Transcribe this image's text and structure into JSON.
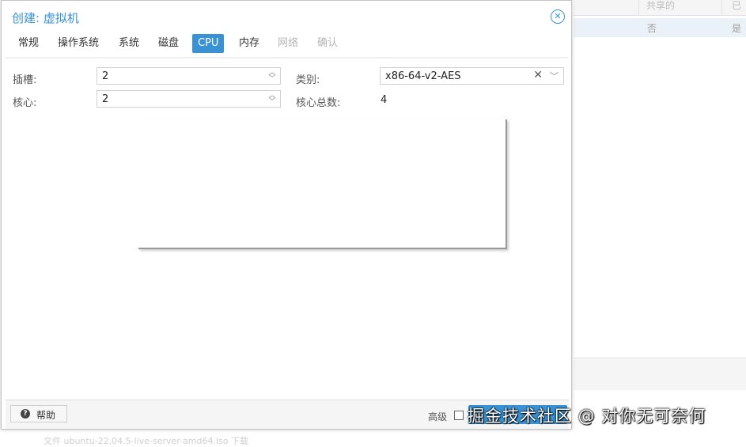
{
  "background": {
    "col_shared": "共享的",
    "col_already": "已",
    "row_no": "否",
    "row_yes": "是",
    "footer_text": "文件  ubuntu-22.04.5-live-server-amd64.iso  下载"
  },
  "dialog": {
    "title": "创建: 虚拟机",
    "close_icon": "close-circle-icon",
    "tabs": [
      {
        "label": "常规",
        "state": "normal"
      },
      {
        "label": "操作系统",
        "state": "normal"
      },
      {
        "label": "系统",
        "state": "normal"
      },
      {
        "label": "磁盘",
        "state": "normal"
      },
      {
        "label": "CPU",
        "state": "active"
      },
      {
        "label": "内存",
        "state": "normal"
      },
      {
        "label": "网络",
        "state": "disabled"
      },
      {
        "label": "确认",
        "state": "disabled"
      }
    ],
    "form": {
      "sockets_label": "插槽:",
      "sockets_value": "2",
      "cores_label": "核心:",
      "cores_value": "2",
      "type_label": "类别:",
      "type_value": "x86-64-v2-AES",
      "total_cores_label": "核心总数:",
      "total_cores_value": "4"
    },
    "footer": {
      "help_label": "帮助",
      "advanced_label": "高级",
      "advanced_checked": false
    }
  },
  "watermark": "掘金技术社区 @ 对你无可奈何",
  "colors": {
    "accent": "#3892d4",
    "disabled_text": "#b5b5b5"
  }
}
